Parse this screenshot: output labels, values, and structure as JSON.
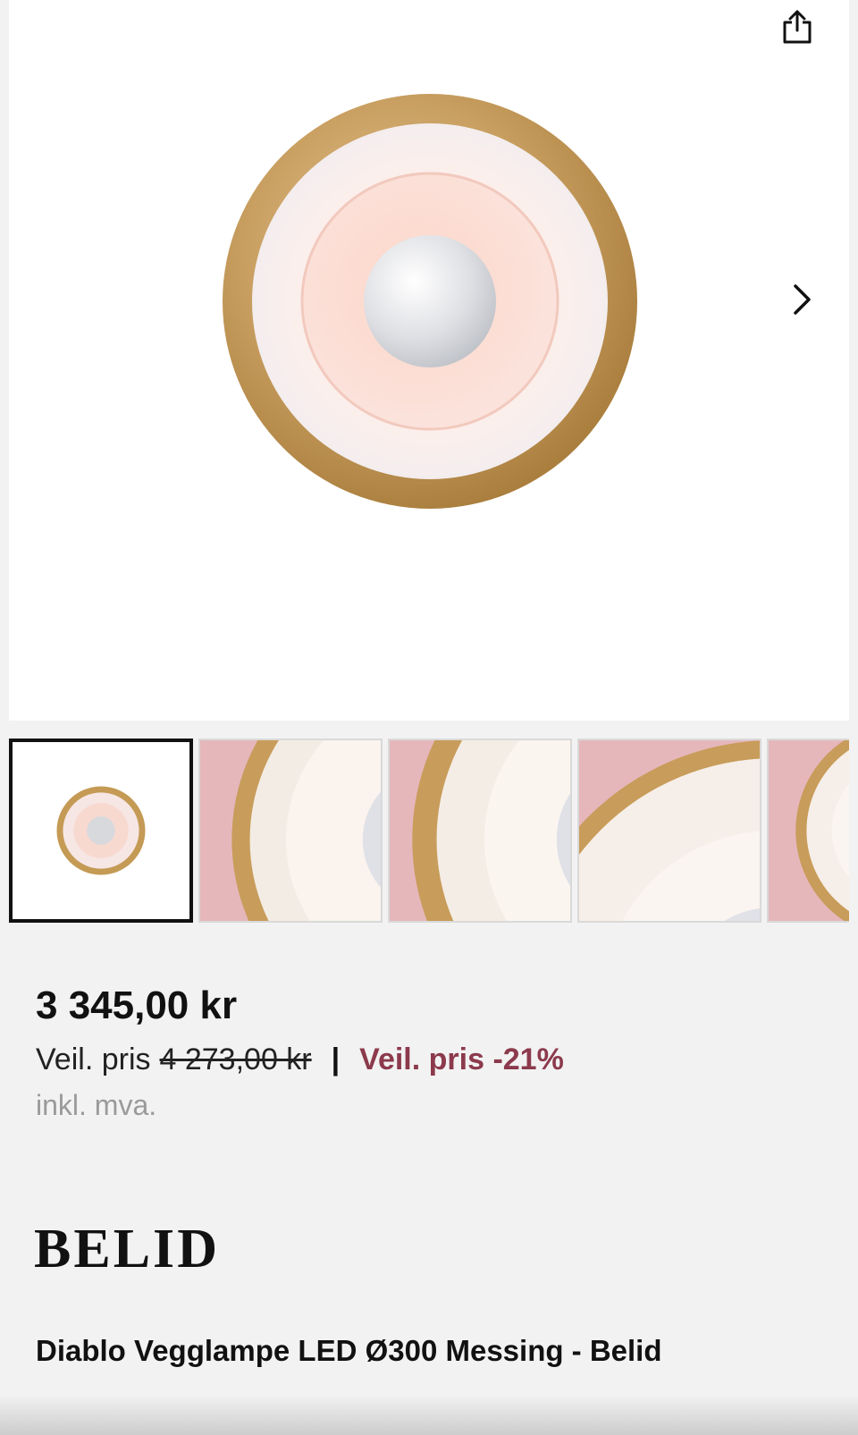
{
  "product": {
    "title": "Diablo Vegglampe LED Ø300 Messing - Belid",
    "brand_logo": "BELID",
    "image_count": 5,
    "active_image": 1
  },
  "pricing": {
    "price": "3 345,00 kr",
    "rec_label": "Veil. pris",
    "rec_old_price": "4 273,00 kr",
    "separator": "|",
    "discount_label": "Veil. pris -21%",
    "vat_note": "inkl. mva."
  },
  "icons": {
    "share": "share-icon",
    "next": "chevron-right-icon"
  },
  "colors": {
    "background": "#f2f2f2",
    "discount": "#8c3a4c",
    "brass": "#c49a55",
    "pink": "#e7b9bd"
  }
}
